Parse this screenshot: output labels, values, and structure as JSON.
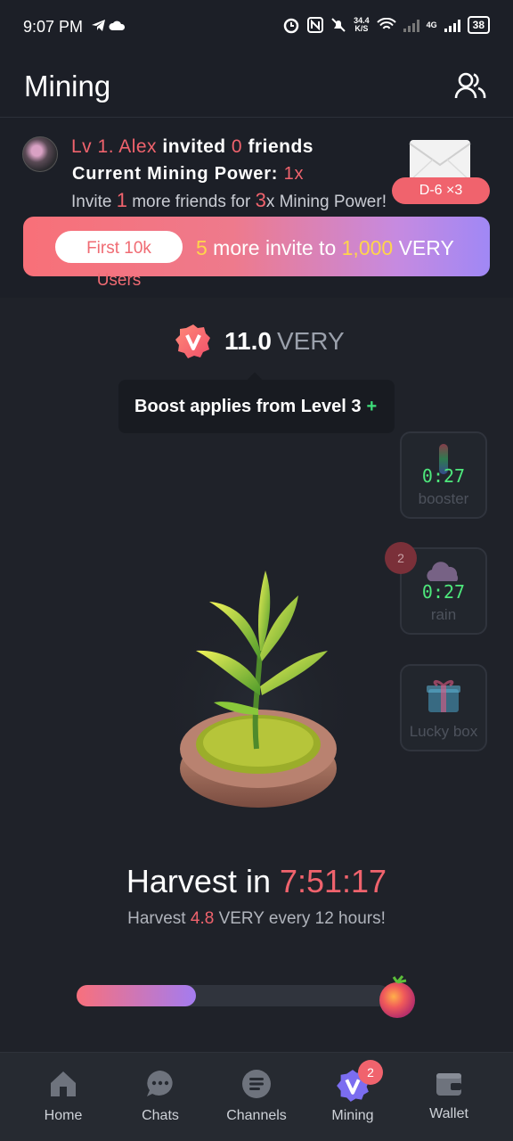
{
  "status_bar": {
    "time": "9:07 PM",
    "net_speed_value": "34.4",
    "net_speed_unit": "K/S",
    "network": "4G",
    "battery": "38"
  },
  "header": {
    "title": "Mining",
    "friends_icon": "friends-icon"
  },
  "invite": {
    "level_name": "Lv 1. Alex",
    "invited_word": " invited ",
    "invited_count": "0",
    "friends_word": " friends",
    "power_label": "Current Mining Power: ",
    "power_value": "1x",
    "more_prefix": "Invite ",
    "more_count": "1",
    "more_mid": " more friends for ",
    "more_mult": "3",
    "more_suffix": "x Mining Power!",
    "envelope_badge": "D-6 ×3",
    "promo_pill": "First 10k Users",
    "promo_count": "5",
    "promo_mid": " more invite to ",
    "promo_amount": "1,000",
    "promo_unit": " VERY"
  },
  "balance": {
    "value": "11.0",
    "unit": "VERY"
  },
  "tooltip": {
    "text": "Boost applies from Level 3",
    "plus": "+"
  },
  "side_cards": {
    "booster": {
      "timer": "0:27",
      "label": "booster"
    },
    "rain": {
      "timer": "0:27",
      "label": "rain",
      "badge": "2"
    },
    "lucky": {
      "label": "Lucky box"
    }
  },
  "harvest": {
    "title_prefix": "Harvest in ",
    "countdown": "7:51:17",
    "sub_prefix": "Harvest ",
    "sub_amount": "4.8",
    "sub_suffix": " VERY every 12 hours!",
    "progress": 0.38
  },
  "nav": {
    "home": "Home",
    "chats": "Chats",
    "channels": "Channels",
    "mining": "Mining",
    "mining_badge": "2",
    "wallet": "Wallet"
  },
  "colors": {
    "accent_red": "#f0636d",
    "accent_green": "#4ee87c",
    "accent_yellow": "#ffd54a",
    "background": "#1c1f27"
  }
}
